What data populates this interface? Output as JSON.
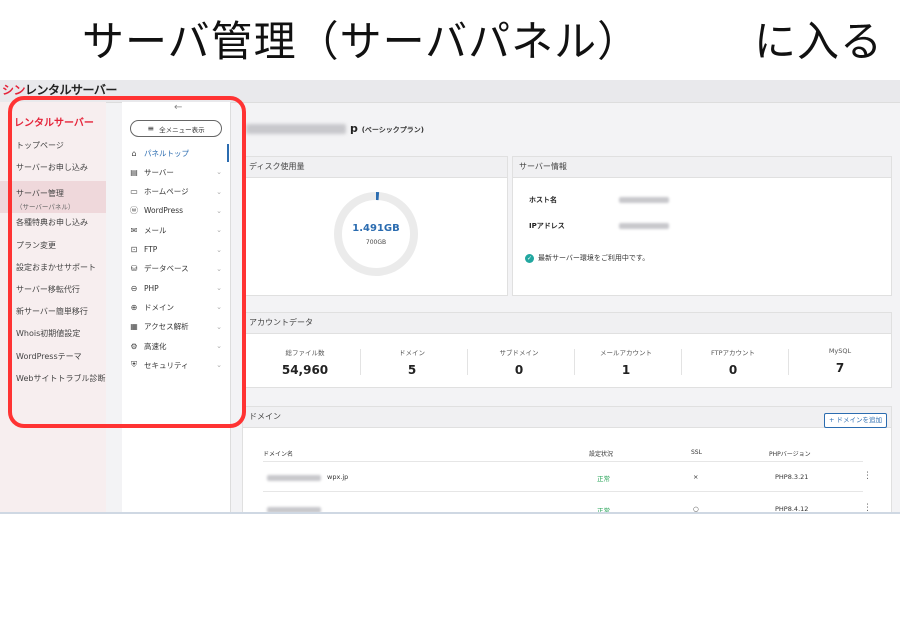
{
  "heading": {
    "left": "サーバ管理（サーバパネル）",
    "right": "に入る"
  },
  "app": {
    "logo_accent": "シン",
    "logo_rest": "レンタルサーバー"
  },
  "left_nav": {
    "brand": "レンタルサーバー",
    "items": [
      {
        "label": "トップページ",
        "sub": ""
      },
      {
        "label": "サーバーお申し込み",
        "sub": ""
      },
      {
        "label": "サーバー管理",
        "sub": "（サーバーパネル）"
      },
      {
        "label": "各種特典お申し込み",
        "sub": ""
      },
      {
        "label": "プラン変更",
        "sub": ""
      },
      {
        "label": "設定おまかせサポート",
        "sub": ""
      },
      {
        "label": "サーバー移転代行",
        "sub": ""
      },
      {
        "label": "新サーバー簡単移行",
        "sub": ""
      },
      {
        "label": "Whois初期値設定",
        "sub": ""
      },
      {
        "label": "WordPressテーマ",
        "sub": ""
      },
      {
        "label": "Webサイトトラブル診断",
        "sub": ""
      }
    ]
  },
  "mid_nav": {
    "back_arrow": "←",
    "menu_button": "全メニュー表示",
    "items": [
      {
        "icon": "⌂",
        "label": "パネルトップ",
        "icon_name": "home-icon"
      },
      {
        "icon": "▤",
        "label": "サーバー",
        "icon_name": "server-icon"
      },
      {
        "icon": "▭",
        "label": "ホームページ",
        "icon_name": "browser-icon"
      },
      {
        "icon": "ⓦ",
        "label": "WordPress",
        "icon_name": "wordpress-icon"
      },
      {
        "icon": "✉",
        "label": "メール",
        "icon_name": "mail-icon"
      },
      {
        "icon": "⊡",
        "label": "FTP",
        "icon_name": "ftp-icon"
      },
      {
        "icon": "⛁",
        "label": "データベース",
        "icon_name": "database-icon"
      },
      {
        "icon": "⊖",
        "label": "PHP",
        "icon_name": "php-icon"
      },
      {
        "icon": "⊕",
        "label": "ドメイン",
        "icon_name": "globe-icon"
      },
      {
        "icon": "▦",
        "label": "アクセス解析",
        "icon_name": "analytics-icon"
      },
      {
        "icon": "⚙",
        "label": "高速化",
        "icon_name": "rocket-icon"
      },
      {
        "icon": "⛨",
        "label": "セキュリティ",
        "icon_name": "shield-icon"
      }
    ]
  },
  "main": {
    "plan_suffix": "p",
    "plan_label": "(ベーシックプラン)",
    "disk": {
      "title": "ディスク使用量",
      "used": "1.491GB",
      "total": "700GB",
      "used_fraction": 0.0021
    },
    "server_info": {
      "title": "サーバー情報",
      "host_label": "ホスト名",
      "ip_label": "IPアドレス",
      "status": "最新サーバー環境をご利用中です。"
    },
    "account": {
      "title": "アカウントデータ",
      "stats": [
        {
          "label": "総ファイル数",
          "value": "54,960"
        },
        {
          "label": "ドメイン",
          "value": "5"
        },
        {
          "label": "サブドメイン",
          "value": "0"
        },
        {
          "label": "メールアカウント",
          "value": "1"
        },
        {
          "label": "FTPアカウント",
          "value": "0"
        },
        {
          "label": "MySQL",
          "value": "7"
        }
      ]
    },
    "domain": {
      "title": "ドメイン",
      "add_button": "+ ドメインを追加",
      "headers": [
        "ドメイン名",
        "設定状況",
        "SSL",
        "PHPバージョン"
      ],
      "rows": [
        {
          "name_suffix": "wpx.jp",
          "status": "正常",
          "ssl": "×",
          "php": "PHP8.3.21"
        },
        {
          "name_suffix": "",
          "status": "正常",
          "ssl": "○",
          "php": "PHP8.4.12"
        }
      ]
    }
  },
  "colors": {
    "brand_red": "#e5243a",
    "accent_blue": "#2b6cb0",
    "frame_red": "#ff3333",
    "ok_green": "#2aa55a"
  }
}
